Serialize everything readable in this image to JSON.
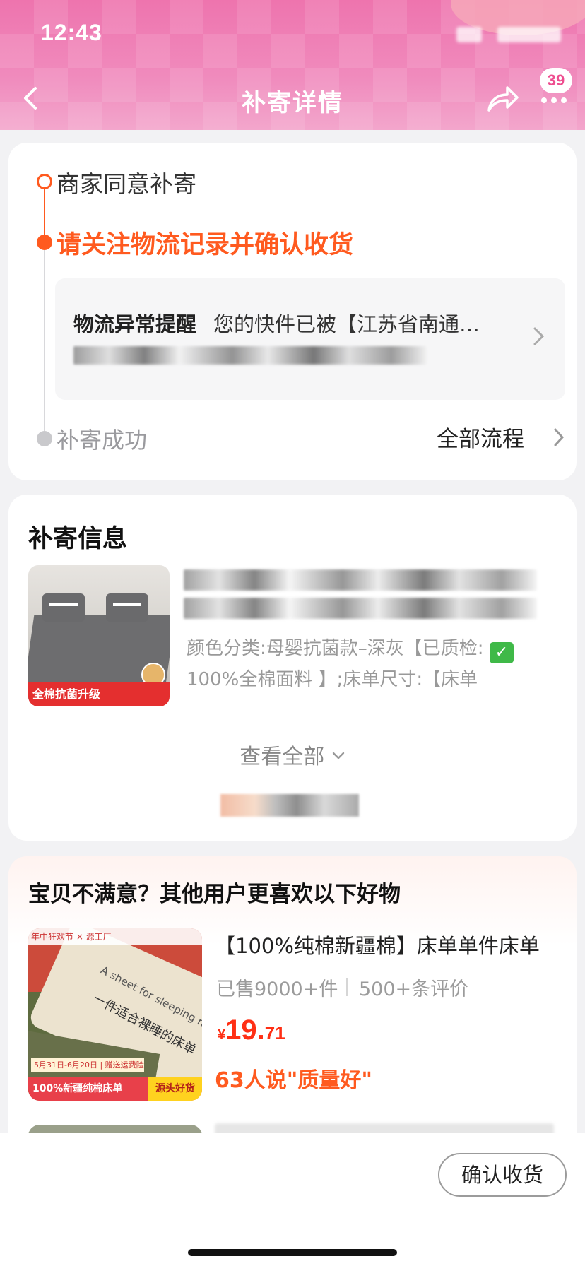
{
  "status_bar": {
    "time": "12:43"
  },
  "nav": {
    "title": "补寄详情",
    "badge_count": "39"
  },
  "progress": {
    "steps": [
      {
        "label": "商家同意补寄",
        "state": "done"
      },
      {
        "label": "请关注物流记录并确认收货",
        "state": "active"
      },
      {
        "label": "补寄成功",
        "state": "pending"
      }
    ],
    "alert": {
      "title": "物流异常提醒",
      "message": "您的快件已被【江苏省南通…"
    },
    "all_flow_label": "全部流程"
  },
  "resend_info": {
    "title": "补寄信息",
    "product": {
      "image_banner": "全棉抗菌升级",
      "spec": "颜色分类:母婴抗菌款–深灰【已质检: ✅100%全棉面料 】;床单尺寸:【床单"
    },
    "view_all_label": "查看全部"
  },
  "recommendations": {
    "title": "宝贝不满意？其他用户更喜欢以下好物",
    "items": [
      {
        "name": "【100%纯棉新疆棉】床单单件床单",
        "sold": "已售9000+件",
        "reviews": "500+条评价",
        "price_symbol": "¥",
        "price_int": "19.",
        "price_dec": "71",
        "praise": "63人说\"质量好\"",
        "image_text": {
          "script": "A sheet for sleeping naked",
          "headline": "一件适合裸睡的床单",
          "top": "年中狂欢节 × 源工厂",
          "date": "5月31日-6月20日 | 赠送运费险",
          "banner": "100%新疆纯棉床单",
          "tag": "源头好货"
        }
      }
    ]
  },
  "bottom_bar": {
    "confirm_label": "确认收货"
  },
  "colors": {
    "accent": "#ff5a1f",
    "header_pink": "#ee74ae",
    "price_red": "#ff2f14"
  }
}
